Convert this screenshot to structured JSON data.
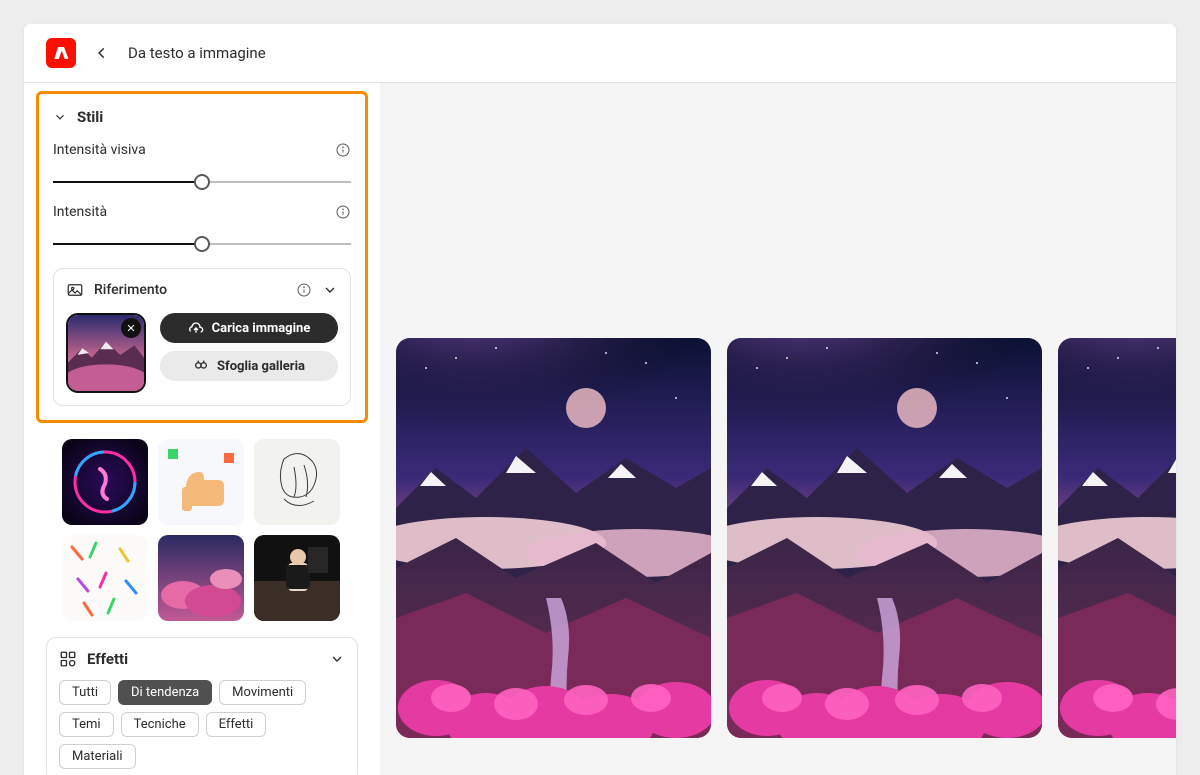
{
  "header": {
    "title": "Da testo a immagine"
  },
  "styles": {
    "section_title": "Stili",
    "slider1_label": "Intensità visiva",
    "slider1_value": 50,
    "slider2_label": "Intensità",
    "slider2_value": 50
  },
  "reference": {
    "title": "Riferimento",
    "upload_label": "Carica immagine",
    "browse_label": "Sfoglia galleria"
  },
  "style_thumbs": [
    {
      "name": "neon-figure"
    },
    {
      "name": "3d-thumbs-up"
    },
    {
      "name": "sketch-bust"
    },
    {
      "name": "confetti-pattern"
    },
    {
      "name": "pink-clouds"
    },
    {
      "name": "man-couch-dark"
    }
  ],
  "effects": {
    "title": "Effetti",
    "chips": [
      {
        "label": "Tutti",
        "active": false
      },
      {
        "label": "Di tendenza",
        "active": true
      },
      {
        "label": "Movimenti",
        "active": false
      },
      {
        "label": "Temi",
        "active": false
      },
      {
        "label": "Tecniche",
        "active": false
      },
      {
        "label": "Effetti",
        "active": false
      },
      {
        "label": "Materiali",
        "active": false
      }
    ]
  },
  "results": {
    "count": 3
  }
}
